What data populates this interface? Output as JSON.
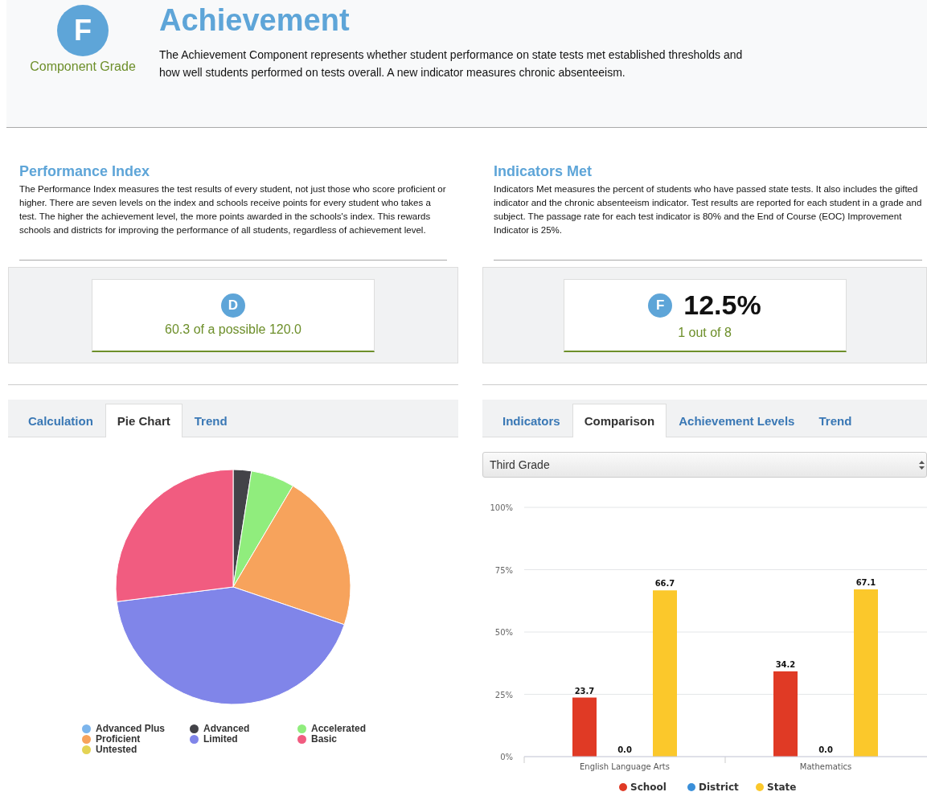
{
  "header": {
    "grade": "F",
    "grade_caption": "Component Grade",
    "title": "Achievement",
    "description": "The Achievement Component represents whether student performance on state tests met established thresholds and how well students performed on tests overall. A new indicator measures chronic absenteeism."
  },
  "performance_index": {
    "title": "Performance Index",
    "description": "The Performance Index measures the test results of every student, not just those who score proficient or higher. There are seven levels on the index and schools receive points for every student who takes a test. The higher the achievement level, the more points awarded in the schools's index. This rewards schools and districts for improving the performance of all students, regardless of achievement level.",
    "grade": "D",
    "score": "60.3 of a possible 120.0",
    "tabs": [
      {
        "label": "Calculation",
        "selected": false
      },
      {
        "label": "Pie Chart",
        "selected": true
      },
      {
        "label": "Trend",
        "selected": false
      }
    ],
    "legend": [
      {
        "label": "Advanced Plus",
        "color": "#7cb5ec"
      },
      {
        "label": "Advanced",
        "color": "#434348"
      },
      {
        "label": "Accelerated",
        "color": "#90ed7d"
      },
      {
        "label": "Proficient",
        "color": "#f7a35c"
      },
      {
        "label": "Limited",
        "color": "#8085e9"
      },
      {
        "label": "Basic",
        "color": "#f15c80"
      },
      {
        "label": "Untested",
        "color": "#e4d354"
      }
    ]
  },
  "indicators_met": {
    "title": "Indicators Met",
    "description": "Indicators Met measures the percent of students who have passed state tests. It also includes the gifted indicator and the chronic absenteeism indicator. Test results are reported for each student in a grade and subject. The passage rate for each test indicator is 80% and the End of Course (EOC) Improvement Indicator is 25%.",
    "grade": "F",
    "percent": "12.5%",
    "detail": "1 out of 8",
    "tabs": [
      {
        "label": "Indicators",
        "selected": false
      },
      {
        "label": "Comparison",
        "selected": true
      },
      {
        "label": "Achievement Levels",
        "selected": false
      },
      {
        "label": "Trend",
        "selected": false
      }
    ],
    "grade_select": {
      "value": "Third Grade"
    },
    "chart_data": {
      "type": "bar",
      "categories": [
        "English Language Arts",
        "Mathematics"
      ],
      "series": [
        {
          "name": "School",
          "color": "#e03a25",
          "values": [
            23.7,
            34.2
          ],
          "value_labels": [
            "23.7",
            "34.2"
          ]
        },
        {
          "name": "District",
          "color": "#3a8fd9",
          "values": [
            0.0,
            0.0
          ],
          "value_labels": [
            "0.0",
            "0.0"
          ]
        },
        {
          "name": "State",
          "color": "#fbc82b",
          "values": [
            66.7,
            67.1
          ],
          "value_labels": [
            "66.7",
            "67.1"
          ]
        }
      ],
      "grid": true,
      "legend": true,
      "ylim": [
        0,
        100
      ],
      "yticks": [
        {
          "value": 0,
          "label": "0%"
        },
        {
          "value": 25,
          "label": "25%"
        },
        {
          "value": 50,
          "label": "50%"
        },
        {
          "value": 75,
          "label": "75%"
        },
        {
          "value": 100,
          "label": "100%"
        }
      ],
      "data_labels": true
    }
  }
}
